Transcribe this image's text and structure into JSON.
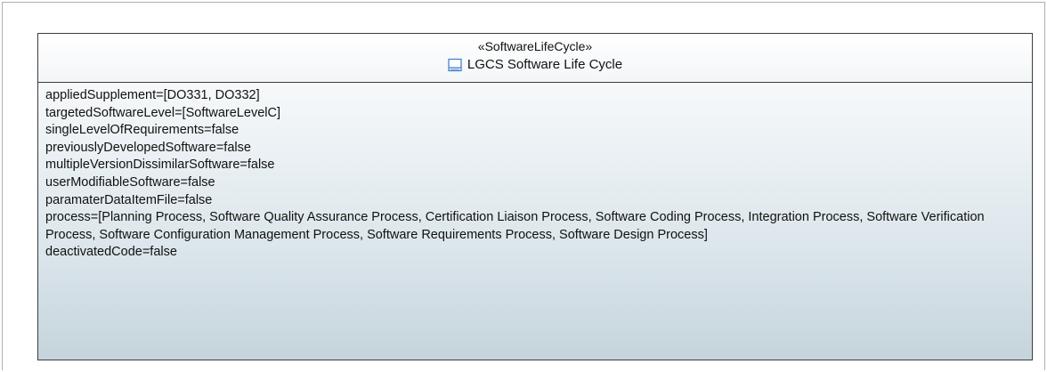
{
  "block": {
    "stereotype": "«SoftwareLifeCycle»",
    "name": "LGCS Software Life Cycle",
    "icon": "block-icon",
    "properties": [
      "appliedSupplement=[DO331, DO332]",
      "targetedSoftwareLevel=[SoftwareLevelC]",
      "singleLevelOfRequirements=false",
      "previouslyDevelopedSoftware=false",
      "multipleVersionDissimilarSoftware=false",
      "userModifiableSoftware=false",
      "paramaterDataItemFile=false",
      "process=[Planning Process, Software Quality Assurance Process, Certification Liaison Process, Software Coding Process, Integration Process, Software Verification Process, Software Configuration Management Process, Software Requirements Process, Software Design Process]",
      "deactivatedCode=false"
    ]
  },
  "colors": {
    "border": "#3c3c3c",
    "icon_stroke": "#3a7bc8",
    "fill_bottom": "#c5d4dc"
  }
}
